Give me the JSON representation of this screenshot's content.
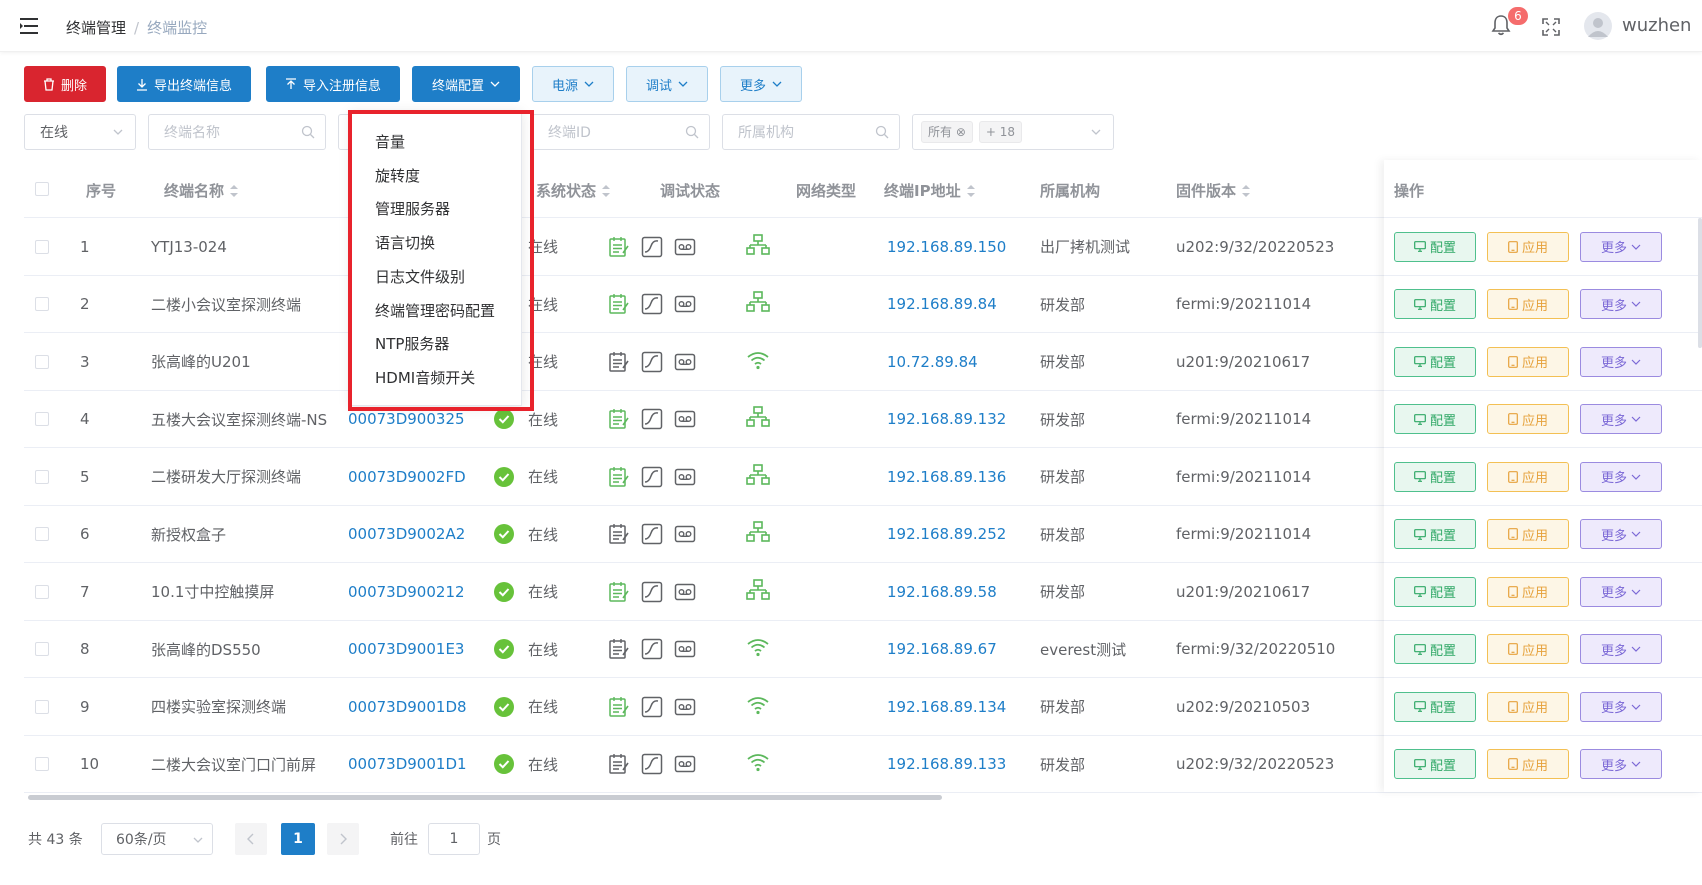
{
  "header": {
    "breadcrumb": [
      "终端管理",
      "终端监控"
    ],
    "separator": "/",
    "notification_count": "6",
    "username": "wuzhen"
  },
  "toolbar": {
    "delete_label": "删除",
    "export_label": "导出终端信息",
    "import_label": "导入注册信息",
    "config_label": "终端配置",
    "power_label": "电源",
    "debug_label": "调试",
    "more_label": "更多"
  },
  "filters": {
    "status_value": "在线",
    "name_placeholder": "终端名称",
    "id_placeholder": "终端ID",
    "org_placeholder": "所属机构",
    "tag_all": "所有",
    "tag_more": "+ 18"
  },
  "dropdown": {
    "items": [
      "音量",
      "旋转度",
      "管理服务器",
      "语言切换",
      "日志文件级别",
      "终端管理密码配置",
      "NTP服务器",
      "HDMI音频开关"
    ]
  },
  "table": {
    "headers": {
      "index": "序号",
      "name": "终端名称",
      "system_status": "系统状态",
      "debug_status": "调试状态",
      "network_type": "网络类型",
      "ip": "终端IP地址",
      "org": "所属机构",
      "firmware": "固件版本",
      "actions": "操作"
    },
    "action_labels": {
      "config": "配置",
      "apply": "应用",
      "more": "更多"
    },
    "rows": [
      {
        "index": "1",
        "name": "YTJ13-024",
        "id": "",
        "status": "在线",
        "network": "wired",
        "ip": "192.168.89.150",
        "org": "出厂拷机测试",
        "firmware": "u202:9/32/20220523",
        "debug_green": true
      },
      {
        "index": "2",
        "name": "二楼小会议室探测终端",
        "id": "",
        "status": "在线",
        "network": "wired",
        "ip": "192.168.89.84",
        "org": "研发部",
        "firmware": "fermi:9/20211014",
        "debug_green": true
      },
      {
        "index": "3",
        "name": "张高峰的U201",
        "id": "",
        "status": "在线",
        "network": "wifi",
        "ip": "10.72.89.84",
        "org": "研发部",
        "firmware": "u201:9/20210617",
        "debug_green": false
      },
      {
        "index": "4",
        "name": "五楼大会议室探测终端-NS",
        "id": "00073D900325",
        "status": "在线",
        "network": "wired",
        "ip": "192.168.89.132",
        "org": "研发部",
        "firmware": "fermi:9/20211014",
        "debug_green": true
      },
      {
        "index": "5",
        "name": "二楼研发大厅探测终端",
        "id": "00073D9002FD",
        "status": "在线",
        "network": "wired",
        "ip": "192.168.89.136",
        "org": "研发部",
        "firmware": "fermi:9/20211014",
        "debug_green": true
      },
      {
        "index": "6",
        "name": "新授权盒子",
        "id": "00073D9002A2",
        "status": "在线",
        "network": "wired",
        "ip": "192.168.89.252",
        "org": "研发部",
        "firmware": "fermi:9/20211014",
        "debug_green": false
      },
      {
        "index": "7",
        "name": "10.1寸中控触摸屏",
        "id": "00073D900212",
        "status": "在线",
        "network": "wired",
        "ip": "192.168.89.58",
        "org": "研发部",
        "firmware": "u201:9/20210617",
        "debug_green": true
      },
      {
        "index": "8",
        "name": "张高峰的DS550",
        "id": "00073D9001E3",
        "status": "在线",
        "network": "wifi",
        "ip": "192.168.89.67",
        "org": "everest测试",
        "firmware": "fermi:9/32/20220510",
        "debug_green": false
      },
      {
        "index": "9",
        "name": "四楼实验室探测终端",
        "id": "00073D9001D8",
        "status": "在线",
        "network": "wifi",
        "ip": "192.168.89.134",
        "org": "研发部",
        "firmware": "u202:9/20210503",
        "debug_green": true
      },
      {
        "index": "10",
        "name": "二楼大会议室门口门前屏",
        "id": "00073D9001D1",
        "status": "在线",
        "network": "wifi",
        "ip": "192.168.89.133",
        "org": "研发部",
        "firmware": "u202:9/32/20220523",
        "debug_green": false
      }
    ]
  },
  "pagination": {
    "total": "共 43 条",
    "page_size": "60条/页",
    "current": "1",
    "goto_prefix": "前往",
    "goto_value": "1",
    "goto_suffix": "页"
  },
  "colors": {
    "primary": "#1e7ec8",
    "danger": "#d9252f",
    "success": "#52c41a",
    "highlight_border": "#e8232c"
  }
}
